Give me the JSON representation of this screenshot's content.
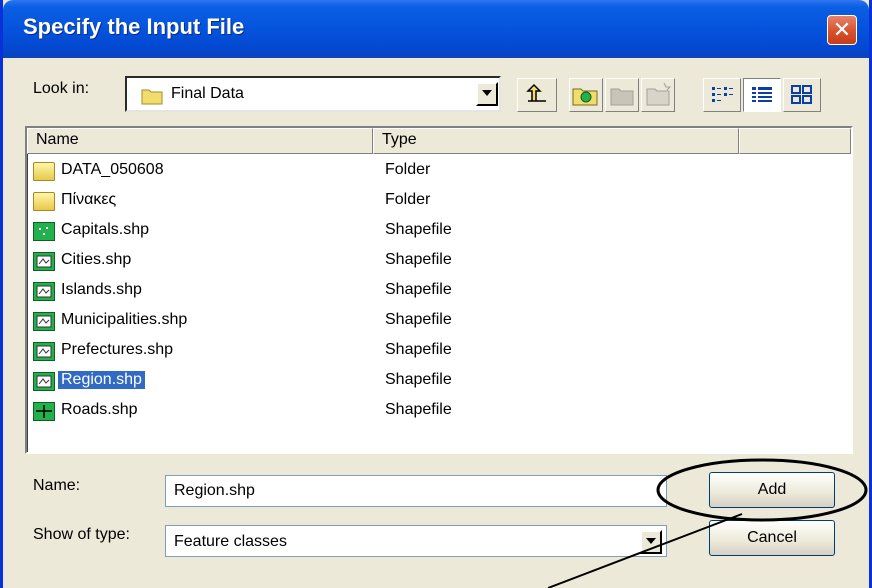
{
  "window": {
    "title": "Specify the Input File",
    "close_symbol": "✕"
  },
  "lookin": {
    "label": "Look in:",
    "value": "Final Data",
    "icon": "folder-icon"
  },
  "toolbar": {
    "buttons": [
      "up-one-level-icon",
      "connect-folder-icon",
      "disconnect-folder-icon",
      "new-folder-icon",
      "list-view-icon",
      "details-view-icon",
      "thumbnails-view-icon"
    ]
  },
  "list": {
    "columns": [
      "Name",
      "Type",
      ""
    ],
    "rows": [
      {
        "name": "DATA_050608",
        "type": "Folder",
        "icon": "folder-icon",
        "selected": false
      },
      {
        "name": "Πίνακες",
        "type": "Folder",
        "icon": "folder-icon",
        "selected": false
      },
      {
        "name": "Capitals.shp",
        "type": "Shapefile",
        "icon": "point-shapefile-icon",
        "selected": false
      },
      {
        "name": "Cities.shp",
        "type": "Shapefile",
        "icon": "polygon-shapefile-icon",
        "selected": false
      },
      {
        "name": "Islands.shp",
        "type": "Shapefile",
        "icon": "polygon-shapefile-icon",
        "selected": false
      },
      {
        "name": "Municipalities.shp",
        "type": "Shapefile",
        "icon": "polygon-shapefile-icon",
        "selected": false
      },
      {
        "name": "Prefectures.shp",
        "type": "Shapefile",
        "icon": "polygon-shapefile-icon",
        "selected": false
      },
      {
        "name": "Region.shp",
        "type": "Shapefile",
        "icon": "polygon-shapefile-icon",
        "selected": true
      },
      {
        "name": "Roads.shp",
        "type": "Shapefile",
        "icon": "line-shapefile-icon",
        "selected": false
      }
    ]
  },
  "form": {
    "name_label": "Name:",
    "name_value": "Region.shp",
    "type_label": "Show of type:",
    "type_value": "Feature classes"
  },
  "buttons": {
    "add": "Add",
    "cancel": "Cancel"
  },
  "colors": {
    "titlebar": "#0553dd",
    "selection": "#316ac5",
    "dialog": "#ece9d8",
    "close": "#d8522c"
  }
}
